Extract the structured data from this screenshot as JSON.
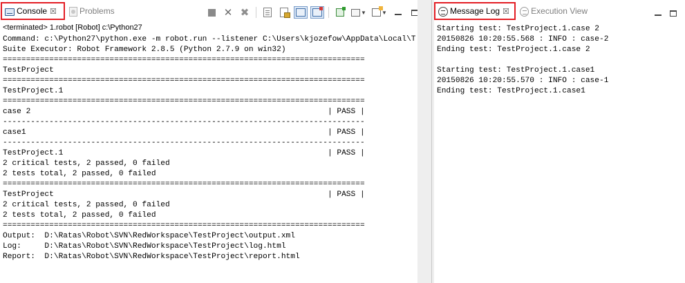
{
  "console_tab": {
    "label": "Console",
    "close": "☒"
  },
  "problems_tab": {
    "label": "Problems"
  },
  "status_line": "<terminated> 1.robot [Robot] c:\\Python27",
  "console_output": "Command: c:\\Python27\\python.exe -m robot.run --listener C:\\Users\\kjozefow\\AppData\\Local\\Temp\nSuite Executor: Robot Framework 2.8.5 (Python 2.7.9 on win32)\n==============================================================================\nTestProject\n==============================================================================\nTestProject.1\n==============================================================================\ncase 2                                                                | PASS |\n------------------------------------------------------------------------------\ncase1                                                                 | PASS |\n------------------------------------------------------------------------------\nTestProject.1                                                         | PASS |\n2 critical tests, 2 passed, 0 failed\n2 tests total, 2 passed, 0 failed\n==============================================================================\nTestProject                                                           | PASS |\n2 critical tests, 2 passed, 0 failed\n2 tests total, 2 passed, 0 failed\n==============================================================================\nOutput:  D:\\Ratas\\Robot\\SVN\\RedWorkspace\\TestProject\\output.xml\nLog:     D:\\Ratas\\Robot\\SVN\\RedWorkspace\\TestProject\\log.html\nReport:  D:\\Ratas\\Robot\\SVN\\RedWorkspace\\TestProject\\report.html",
  "message_log_tab": {
    "label": "Message Log",
    "close": "☒"
  },
  "execution_view_tab": {
    "label": "Execution View"
  },
  "message_log_output": "Starting test: TestProject.1.case 2\n20150826 10:20:55.568 : INFO : case-2\nEnding test: TestProject.1.case 2\n\nStarting test: TestProject.1.case1\n20150826 10:20:55.570 : INFO : case-1\nEnding test: TestProject.1.case1",
  "icons": {
    "console": "console-icon",
    "problems": "problems-icon",
    "terminate": "stop-icon",
    "remove_launch": "remove-launch-icon",
    "remove_all": "remove-all-terminated-icon",
    "clear": "clear-console-icon",
    "scroll_lock": "scroll-lock-icon",
    "word_wrap": "word-wrap-icon",
    "show_on_output": "show-console-on-output-icon",
    "pin": "pin-console-icon",
    "display_selected": "display-selected-console-icon",
    "open_console": "open-console-icon",
    "minimize": "minimize-icon",
    "maximize": "maximize-icon",
    "message_log": "message-log-icon",
    "execution_view": "execution-view-icon"
  },
  "colors": {
    "highlight_border": "#e31c23",
    "pressed_bg": "#dce8f7"
  }
}
